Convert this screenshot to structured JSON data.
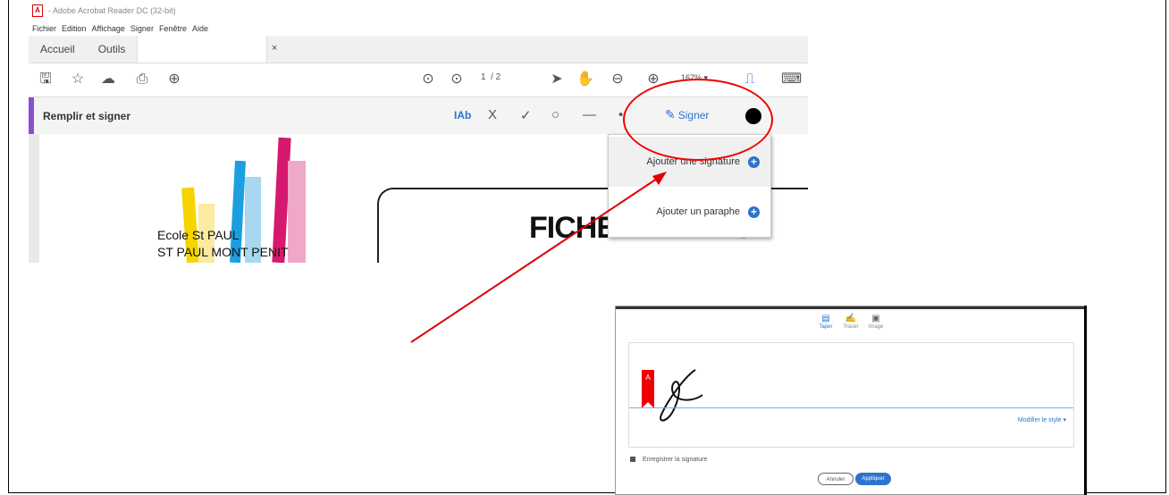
{
  "window": {
    "title": "- Adobe Acrobat Reader DC (32-bit)"
  },
  "menu": [
    "Fichier",
    "Edition",
    "Affichage",
    "Signer",
    "Fenêtre",
    "Aide"
  ],
  "tabs": {
    "home": "Accueil",
    "tools": "Outils",
    "close": "×"
  },
  "toolbar": {
    "page_current": "1",
    "page_total": "/ 2",
    "zoom": "167%"
  },
  "fill_sign": {
    "title": "Remplir et signer",
    "text_tool": "IAb",
    "cross_tool": "X",
    "check_tool": "✓",
    "signer_label": "Signer"
  },
  "dropdown": {
    "add_signature": "Ajouter une signature",
    "add_initials": "Ajouter un paraphe"
  },
  "document": {
    "school_line1": "Ecole St PAUL",
    "school_line2": "ST PAUL MONT PENIT",
    "heading": "FICHE DE RENSE"
  },
  "dialog": {
    "tab_type": "Taper",
    "tab_draw": "Tracer",
    "tab_image": "Image",
    "modify_style": "Modifier le style ▾",
    "save_signature": "Enregistrer la signature",
    "cancel": "Annuler",
    "apply": "Appliquer"
  },
  "colors": {
    "accent_blue": "#2d73cc",
    "annotation_red": "#e00000",
    "fill_sign_purple": "#8a4fcf"
  }
}
